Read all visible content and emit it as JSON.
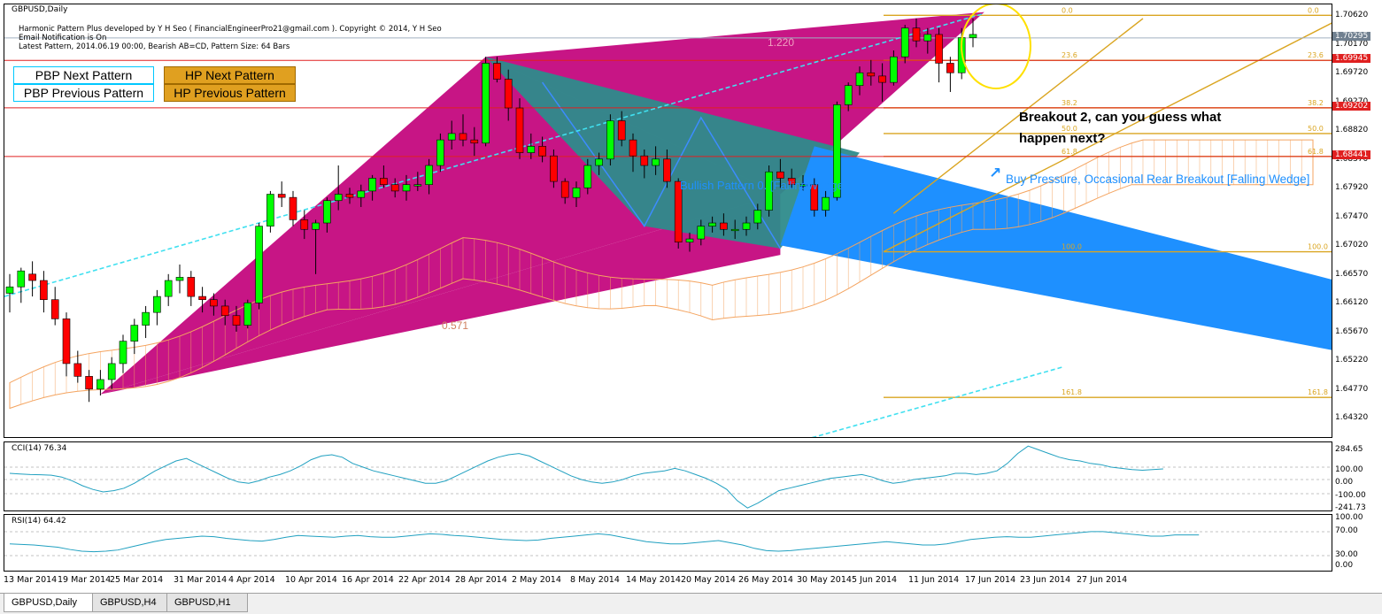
{
  "window": {
    "symbol_title": "GBPUSD,Daily"
  },
  "info_lines": [
    "Harmonic Pattern Plus developed by Y H Seo ( FinancialEngineerPro21@gmail.com ). Copyright © 2014, Y H Seo",
    "Email Notification is On",
    "Latest Pattern, 2014.06.19 00:00, Bearish AB=CD, Pattern Size: 64 Bars"
  ],
  "buttons": {
    "pbp_next": "PBP Next Pattern",
    "pbp_prev": "PBP Previous Pattern",
    "hp_next": "HP Next Pattern",
    "hp_prev": "HP Previous Pattern"
  },
  "annotations": {
    "ratio_top": "1.220",
    "ratio_bottom": "0.571",
    "bullish_pattern": "Bullish Pattern 0. [FallingWedge]",
    "buy_pressure": "Buy Pressure, Occasional Rear Breakout [Falling Wedge]",
    "breakout_line1": "Breakout 2, can you guess what",
    "breakout_line2": "happen next?"
  },
  "fib_levels": [
    {
      "label": "0.0",
      "price": 1.7065
    },
    {
      "label": "23.6",
      "price": 1.69945
    },
    {
      "label": "38.2",
      "price": 1.69202
    },
    {
      "label": "50.0",
      "price": 1.688
    },
    {
      "label": "61.8",
      "price": 1.68441
    },
    {
      "label": "100.0",
      "price": 1.6695
    },
    {
      "label": "161.8",
      "price": 1.6467
    }
  ],
  "price_axis": {
    "min": 1.6405,
    "max": 1.7082,
    "ticks": [
      "1.70620",
      "1.70170",
      "1.69720",
      "1.69270",
      "1.68820",
      "1.68370",
      "1.67920",
      "1.67470",
      "1.67020",
      "1.66570",
      "1.66120",
      "1.65670",
      "1.65220",
      "1.64770",
      "1.64320"
    ],
    "current_price": "1.70295",
    "highlight_1": "1.69945",
    "highlight_2": "1.69202",
    "highlight_3": "1.68441",
    "current_color": "#708090",
    "highlight_color": "#e02020"
  },
  "cci": {
    "title": "CCI(14) 76.34",
    "ticks": [
      "284.65",
      "100.00",
      "0.00",
      "-100.00",
      "-241.73"
    ]
  },
  "rsi": {
    "title": "RSI(14) 64.42",
    "ticks": [
      "100.00",
      "70.00",
      "30.00",
      "0.00"
    ]
  },
  "date_labels": [
    "13 Mar 2014",
    "19 Mar 2014",
    "25 Mar 2014",
    "31 Mar 2014",
    "4 Apr 2014",
    "10 Apr 2014",
    "16 Apr 2014",
    "22 Apr 2014",
    "28 Apr 2014",
    "2 May 2014",
    "8 May 2014",
    "14 May 2014",
    "20 May 2014",
    "26 May 2014",
    "30 May 2014",
    "5 Jun 2014",
    "11 Jun 2014",
    "17 Jun 2014",
    "23 Jun 2014",
    "27 Jun 2014"
  ],
  "tabs": [
    "GBPUSD,Daily",
    "GBPUSD,H4",
    "GBPUSD,H1"
  ],
  "colors": {
    "bull_candle": "#00ff00",
    "bear_candle": "#ff0000",
    "magenta_pattern": "#c71585",
    "teal_pattern": "#2e8b8b",
    "blue_wedge": "#1e90ff",
    "fib_line": "#daa520",
    "cloud": "#f4a460",
    "cyan_dash": "#40e0f0",
    "indicator_line": "#20a0c0"
  },
  "chart_data": {
    "type": "candlestick",
    "symbol": "GBPUSD",
    "timeframe": "Daily",
    "ylim": [
      1.6405,
      1.7082
    ],
    "candles": [
      [
        1.663,
        1.666,
        1.66,
        1.664
      ],
      [
        1.664,
        1.667,
        1.6615,
        1.6665
      ],
      [
        1.666,
        1.668,
        1.6625,
        1.665
      ],
      [
        1.665,
        1.6665,
        1.66,
        1.662
      ],
      [
        1.662,
        1.664,
        1.658,
        1.659
      ],
      [
        1.659,
        1.66,
        1.65,
        1.652
      ],
      [
        1.652,
        1.654,
        1.649,
        1.65
      ],
      [
        1.65,
        1.651,
        1.646,
        1.648
      ],
      [
        1.648,
        1.651,
        1.647,
        1.6495
      ],
      [
        1.6495,
        1.653,
        1.648,
        1.652
      ],
      [
        1.652,
        1.6565,
        1.6505,
        1.6555
      ],
      [
        1.6555,
        1.659,
        1.6535,
        1.658
      ],
      [
        1.658,
        1.661,
        1.656,
        1.66
      ],
      [
        1.66,
        1.6635,
        1.658,
        1.6625
      ],
      [
        1.6625,
        1.666,
        1.661,
        1.665
      ],
      [
        1.665,
        1.6675,
        1.663,
        1.6655
      ],
      [
        1.6655,
        1.6665,
        1.661,
        1.6625
      ],
      [
        1.6625,
        1.664,
        1.66,
        1.662
      ],
      [
        1.662,
        1.663,
        1.6595,
        1.661
      ],
      [
        1.661,
        1.662,
        1.658,
        1.6595
      ],
      [
        1.6595,
        1.661,
        1.657,
        1.658
      ],
      [
        1.658,
        1.662,
        1.6575,
        1.6615
      ],
      [
        1.6615,
        1.674,
        1.6605,
        1.6735
      ],
      [
        1.6735,
        1.679,
        1.6725,
        1.6785
      ],
      [
        1.6785,
        1.6805,
        1.6765,
        1.678
      ],
      [
        1.678,
        1.679,
        1.6735,
        1.6745
      ],
      [
        1.6745,
        1.676,
        1.6715,
        1.673
      ],
      [
        1.673,
        1.6745,
        1.666,
        1.674
      ],
      [
        1.674,
        1.678,
        1.6725,
        1.6775
      ],
      [
        1.6775,
        1.683,
        1.676,
        1.6785
      ],
      [
        1.6785,
        1.6795,
        1.677,
        1.678
      ],
      [
        1.678,
        1.68,
        1.6765,
        1.679
      ],
      [
        1.679,
        1.6815,
        1.6775,
        1.681
      ],
      [
        1.681,
        1.683,
        1.6795,
        1.68
      ],
      [
        1.68,
        1.681,
        1.678,
        1.679
      ],
      [
        1.679,
        1.6815,
        1.6775,
        1.68
      ],
      [
        1.68,
        1.682,
        1.679,
        1.68
      ],
      [
        1.68,
        1.684,
        1.6785,
        1.683
      ],
      [
        1.683,
        1.688,
        1.682,
        1.687
      ],
      [
        1.687,
        1.69,
        1.6855,
        1.688
      ],
      [
        1.688,
        1.691,
        1.686,
        1.687
      ],
      [
        1.687,
        1.689,
        1.6845,
        1.6865
      ],
      [
        1.6865,
        1.7,
        1.686,
        1.699
      ],
      [
        1.699,
        1.7,
        1.696,
        1.6965
      ],
      [
        1.6965,
        1.698,
        1.69,
        1.692
      ],
      [
        1.692,
        1.6935,
        1.684,
        1.685
      ],
      [
        1.685,
        1.688,
        1.684,
        1.686
      ],
      [
        1.686,
        1.6875,
        1.6835,
        1.6845
      ],
      [
        1.6845,
        1.6855,
        1.6795,
        1.6805
      ],
      [
        1.6805,
        1.681,
        1.677,
        1.678
      ],
      [
        1.678,
        1.6805,
        1.6765,
        1.6795
      ],
      [
        1.6795,
        1.684,
        1.6785,
        1.683
      ],
      [
        1.683,
        1.685,
        1.6815,
        1.684
      ],
      [
        1.684,
        1.691,
        1.683,
        1.69
      ],
      [
        1.69,
        1.6915,
        1.686,
        1.687
      ],
      [
        1.687,
        1.688,
        1.682,
        1.6845
      ],
      [
        1.6845,
        1.6855,
        1.681,
        1.683
      ],
      [
        1.683,
        1.686,
        1.6815,
        1.684
      ],
      [
        1.684,
        1.6855,
        1.6795,
        1.6805
      ],
      [
        1.6805,
        1.681,
        1.67,
        1.671
      ],
      [
        1.671,
        1.6725,
        1.6695,
        1.6715
      ],
      [
        1.6715,
        1.6745,
        1.6705,
        1.6735
      ],
      [
        1.6735,
        1.675,
        1.6725,
        1.674
      ],
      [
        1.674,
        1.6755,
        1.672,
        1.673
      ],
      [
        1.673,
        1.6745,
        1.6715,
        1.673
      ],
      [
        1.673,
        1.675,
        1.672,
        1.674
      ],
      [
        1.674,
        1.677,
        1.673,
        1.676
      ],
      [
        1.676,
        1.683,
        1.675,
        1.682
      ],
      [
        1.682,
        1.684,
        1.6795,
        1.681
      ],
      [
        1.681,
        1.6825,
        1.6795,
        1.68
      ],
      [
        1.68,
        1.6815,
        1.679,
        1.68
      ],
      [
        1.68,
        1.681,
        1.675,
        1.676
      ],
      [
        1.676,
        1.679,
        1.675,
        1.678
      ],
      [
        1.678,
        1.693,
        1.6775,
        1.6925
      ],
      [
        1.6925,
        1.696,
        1.6915,
        1.6955
      ],
      [
        1.6955,
        1.6985,
        1.694,
        1.6975
      ],
      [
        1.6975,
        1.6995,
        1.6955,
        1.697
      ],
      [
        1.697,
        1.699,
        1.693,
        1.696
      ],
      [
        1.696,
        1.701,
        1.6955,
        1.7
      ],
      [
        1.7,
        1.705,
        1.699,
        1.7045
      ],
      [
        1.7045,
        1.706,
        1.7015,
        1.7025
      ],
      [
        1.7025,
        1.7045,
        1.7005,
        1.7035
      ],
      [
        1.7035,
        1.7045,
        1.696,
        1.699
      ],
      [
        1.699,
        1.7,
        1.6945,
        1.6975
      ],
      [
        1.6975,
        1.7045,
        1.6965,
        1.703
      ],
      [
        1.703,
        1.706,
        1.7015,
        1.7035
      ]
    ]
  }
}
